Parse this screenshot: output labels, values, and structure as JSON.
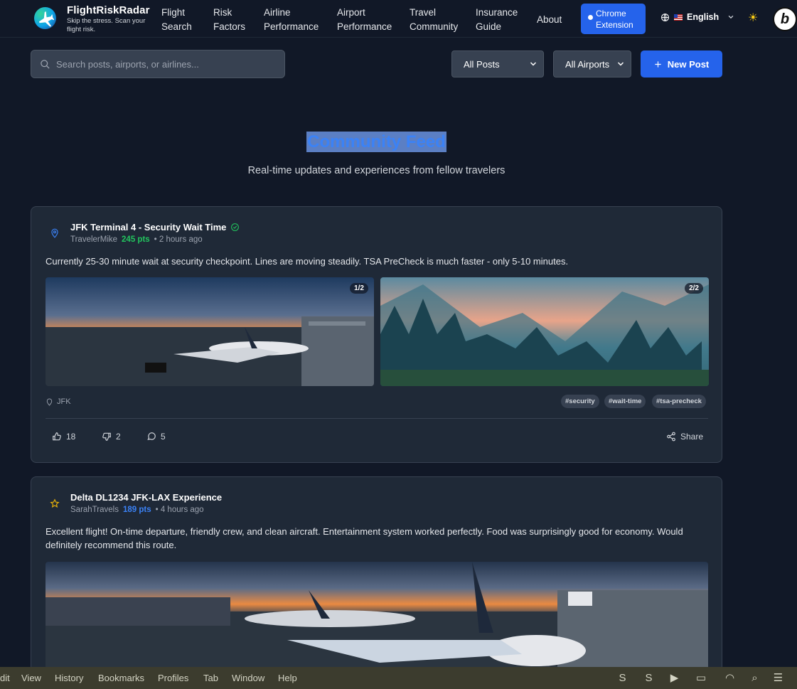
{
  "nav": {
    "brand": "FlightRiskRadar",
    "tagline": "Skip the stress. Scan your flight risk.",
    "links": [
      {
        "label": "Flight Search"
      },
      {
        "label": "Risk Factors"
      },
      {
        "label": "Airline Performance"
      },
      {
        "label": "Airport Performance"
      },
      {
        "label": "Travel Community"
      },
      {
        "label": "Insurance Guide"
      },
      {
        "label": "About"
      }
    ],
    "chrome_button": "Chrome Extension",
    "language": "English",
    "avatar_letter": "b"
  },
  "toolbar": {
    "search_placeholder": "Search posts, airports, or airlines...",
    "posts_filter": "All Posts",
    "airports_filter": "All Airports",
    "new_post": "New Post"
  },
  "header": {
    "title": "Community Feed",
    "subtitle": "Real-time updates and experiences from fellow travelers"
  },
  "posts": [
    {
      "title": "JFK Terminal 4 - Security Wait Time",
      "author": "TravelerMike",
      "points": "245 pts",
      "time": "• 2 hours ago",
      "body": "Currently 25-30 minute wait at security checkpoint. Lines are moving steadily. TSA PreCheck is much faster - only 5-10 minutes.",
      "images": [
        {
          "badge": "1/2"
        },
        {
          "badge": "2/2"
        }
      ],
      "location": "JFK",
      "tags": [
        "#security",
        "#wait-time",
        "#tsa-precheck"
      ],
      "likes": "18",
      "dislikes": "2",
      "comments": "5",
      "share": "Share"
    },
    {
      "title": "Delta DL1234 JFK-LAX Experience",
      "author": "SarahTravels",
      "points": "189 pts",
      "time": "• 4 hours ago",
      "body": "Excellent flight! On-time departure, friendly crew, and clean aircraft. Entertainment system worked perfectly. Food was surprisingly good for economy. Would definitely recommend this route."
    }
  ],
  "os_menu": {
    "items": [
      "dit",
      "View",
      "History",
      "Bookmarks",
      "Profiles",
      "Tab",
      "Window",
      "Help"
    ]
  },
  "colors": {
    "accent": "#2563eb",
    "background": "#111827",
    "card": "#1f2937",
    "points_green": "#22c55e",
    "points_blue": "#3b82f6"
  }
}
